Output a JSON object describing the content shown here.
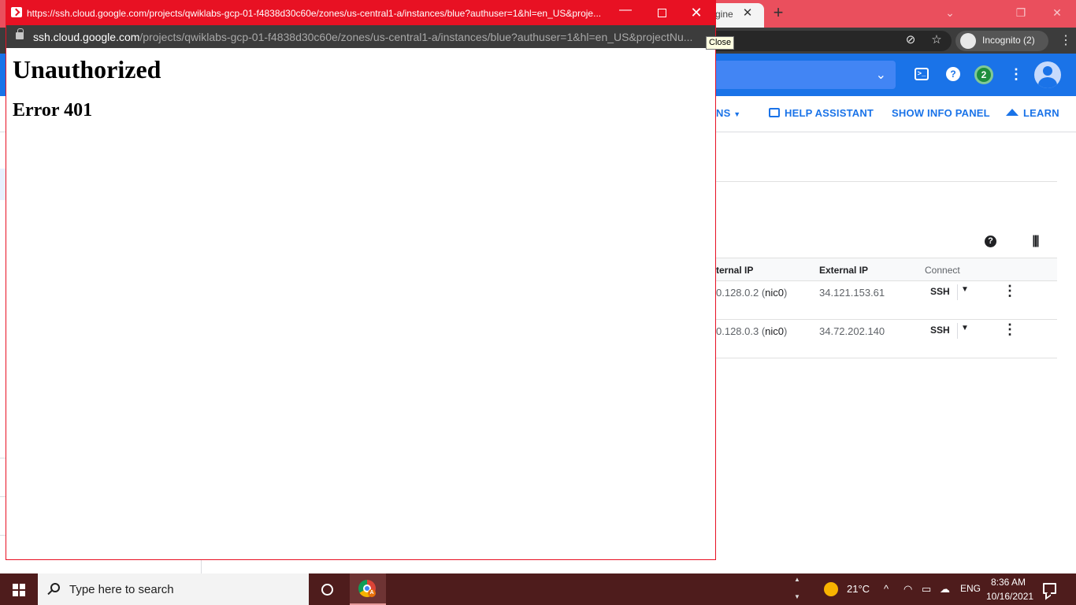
{
  "background": {
    "tab": {
      "title": "gine"
    },
    "toolbar": {
      "incognito_label": "Incognito (2)"
    },
    "tooltip": "Close",
    "header": {
      "notifications_count": "2"
    },
    "actions": [
      {
        "label": "NS",
        "id": "partial"
      },
      {
        "label": "HELP ASSISTANT",
        "id": "help-assistant"
      },
      {
        "label": "SHOW INFO PANEL",
        "id": "show-info-panel"
      },
      {
        "label": "LEARN",
        "id": "learn"
      }
    ],
    "table": {
      "columns": {
        "internal_ip": "ternal IP",
        "external_ip": "External IP",
        "connect": "Connect"
      },
      "rows": [
        {
          "internal_ip": "0.128.0.2",
          "nic": "nic0",
          "external_ip": "34.121.153.61",
          "connect": "SSH"
        },
        {
          "internal_ip": "0.128.0.3",
          "nic": "nic0",
          "external_ip": "34.72.202.140",
          "connect": "SSH"
        }
      ]
    }
  },
  "popup": {
    "title": "https://ssh.cloud.google.com/projects/qwiklabs-gcp-01-f4838d30c60e/zones/us-central1-a/instances/blue?authuser=1&hl=en_US&proje...",
    "address_host": "ssh.cloud.google.com",
    "address_path": "/projects/qwiklabs-gcp-01-f4838d30c60e/zones/us-central1-a/instances/blue?authuser=1&hl=en_US&projectNu...",
    "heading": "Unauthorized",
    "subheading": "Error 401"
  },
  "taskbar": {
    "search_placeholder": "Type here to search",
    "weather": "21°C",
    "language": "ENG",
    "time": "8:36 AM",
    "date": "10/16/2021"
  },
  "colors": {
    "popup_titlebar": "#e81123",
    "background_tabstrip": "#ea4f5d",
    "gcp_blue": "#1a73e8",
    "taskbar": "#4e1c1c"
  },
  "icons": [
    "terminal-icon",
    "help-icon",
    "more-vert-icon",
    "avatar",
    "lock-icon",
    "minimize-icon",
    "maximize-icon",
    "close-icon",
    "windows-logo-icon",
    "search-icon",
    "cortana-icon",
    "chrome-icon",
    "weather-sun-icon",
    "chevron-up-icon",
    "wifi-icon",
    "battery-icon",
    "cloud-icon",
    "notification-icon"
  ]
}
